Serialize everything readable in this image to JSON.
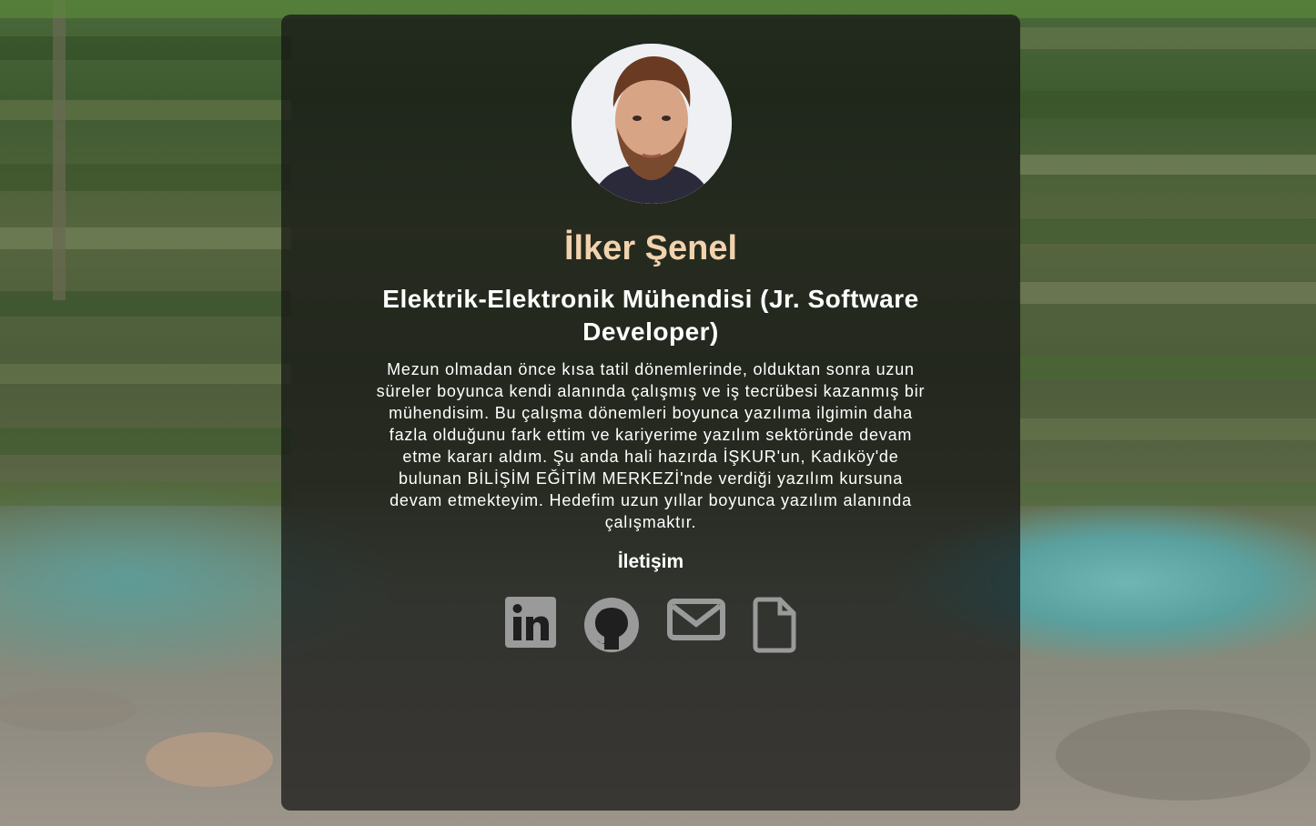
{
  "profile": {
    "name": "İlker Şenel",
    "title": "Elektrik-Elektronik Mühendisi (Jr. Software Developer)",
    "bio": "Mezun olmadan önce kısa tatil dönemlerinde, olduktan sonra uzun süreler boyunca kendi alanında çalışmış ve iş tecrübesi kazanmış bir mühendisim. Bu çalışma dönemleri boyunca yazılıma ilgimin daha fazla olduğunu fark ettim ve kariyerime yazılım sektöründe devam etme kararı aldım. Şu anda hali hazırda İŞKUR'un, Kadıköy'de bulunan BİLİŞİM EĞİTİM MERKEZİ'nde verdiği yazılım kursuna devam etmekteyim. Hedefim uzun yıllar boyunca yazılım alanında çalışmaktır."
  },
  "contact": {
    "heading": "İletişim",
    "links": [
      {
        "icon": "linkedin-icon"
      },
      {
        "icon": "github-icon"
      },
      {
        "icon": "envelope-icon"
      },
      {
        "icon": "file-icon"
      }
    ]
  },
  "colors": {
    "name": "#f2d2ae",
    "text": "#ffffff",
    "icon": "#9a9a9a",
    "card": "rgba(20,20,20,0.72)"
  }
}
